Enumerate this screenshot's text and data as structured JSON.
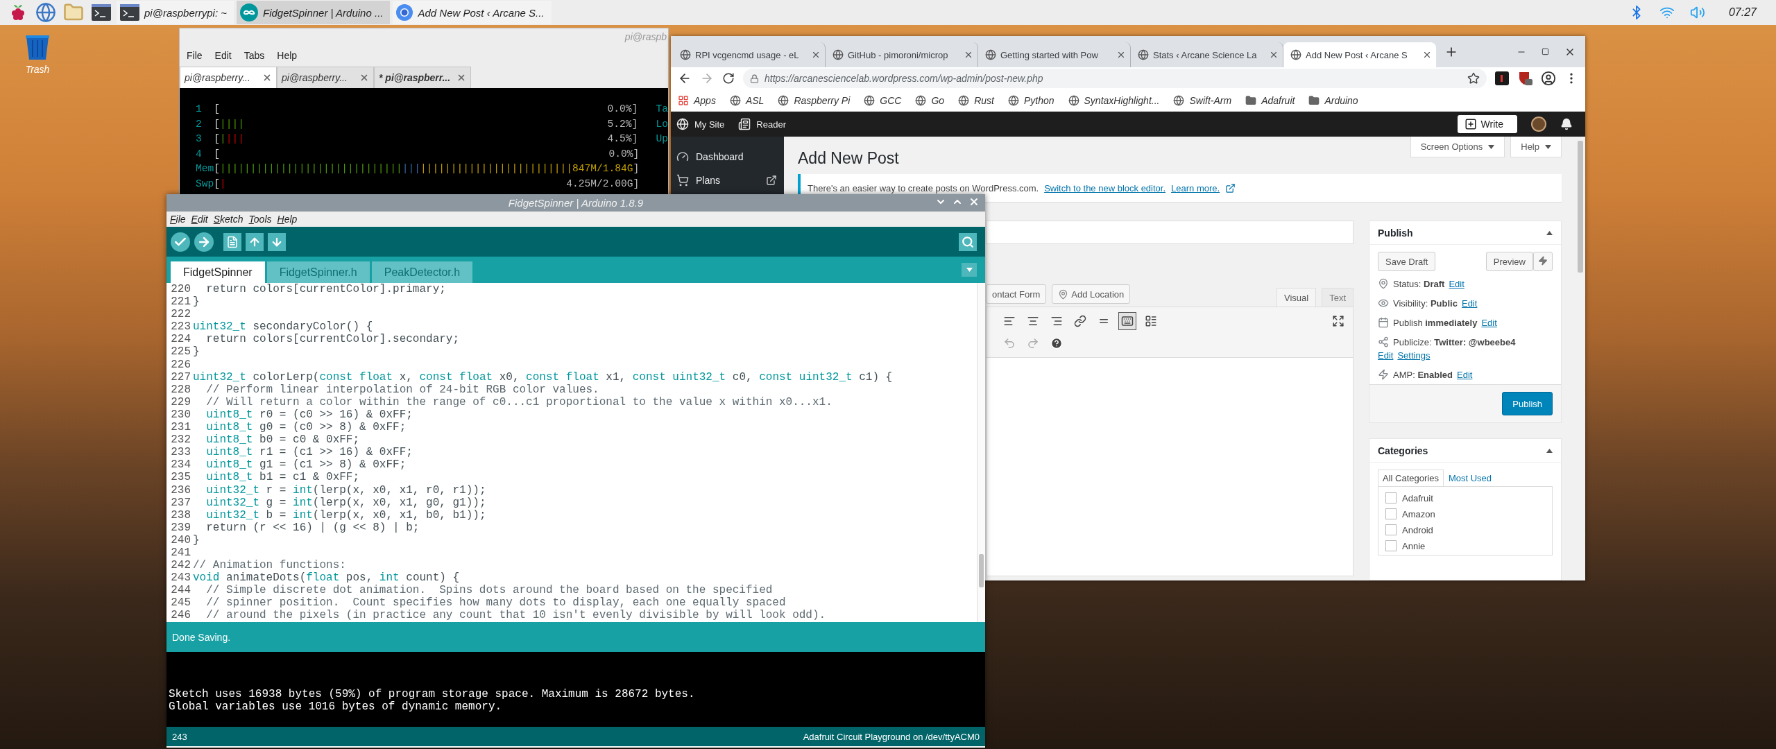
{
  "taskbar": {
    "tasks": [
      {
        "label": "pi@raspberrypi: ~",
        "kind": "terminal",
        "selected": false
      },
      {
        "label": "FidgetSpinner | Arduino ...",
        "kind": "arduino",
        "selected": true
      },
      {
        "label": "Add New Post ‹ Arcane S...",
        "kind": "browser",
        "selected": false
      }
    ],
    "clock": "07:27"
  },
  "desktop": {
    "icons": [
      {
        "label": "Trash"
      }
    ]
  },
  "terminal": {
    "title": "pi@raspb",
    "menu": [
      "File",
      "Edit",
      "Tabs",
      "Help"
    ],
    "tabs": [
      {
        "label": "pi@raspberry...",
        "selected": true,
        "modified": false
      },
      {
        "label": "pi@raspberry...",
        "selected": false,
        "modified": false
      },
      {
        "label": "* pi@raspberr...",
        "selected": false,
        "modified": true
      }
    ],
    "meters": [
      {
        "label": "1",
        "bracket": "[",
        "value": "0.0%]",
        "side": "Ta"
      },
      {
        "label": "2",
        "bracket": "[",
        "segments": [
          {
            "text": "||||",
            "color": "#4e9a06"
          }
        ],
        "value": "5.2%]",
        "side": "Lo"
      },
      {
        "label": "3",
        "bracket": "[",
        "segments": [
          {
            "text": "|",
            "color": "#4e9a06"
          },
          {
            "text": "|||",
            "color": "#cc0000"
          }
        ],
        "value": "4.5%]",
        "side": "Up"
      },
      {
        "label": "4",
        "bracket": "[",
        "value": "0.0%]"
      },
      {
        "label": "Mem",
        "bracket": "[",
        "segments": [
          {
            "text": "||||||||||||||||||||||||||||||",
            "color": "#4e9a06"
          },
          {
            "text": "|||",
            "color": "#3465a4"
          },
          {
            "text": "|||||||||||||||||||||||||847M/1.84G",
            "color": "#c4a000"
          }
        ],
        "value": "]"
      },
      {
        "label": "Swp",
        "bracket": "[",
        "segments": [
          {
            "text": "|",
            "color": "#cc0000"
          }
        ],
        "value": "4.25M/2.00G]"
      }
    ]
  },
  "browser": {
    "tabs": [
      {
        "label": "RPI vcgencmd usage - eL",
        "selected": false
      },
      {
        "label": "GitHub - pimoroni/microp",
        "selected": false
      },
      {
        "label": "Getting started with Pow",
        "selected": false
      },
      {
        "label": "Stats ‹ Arcane Science La",
        "selected": false
      },
      {
        "label": "Add New Post ‹ Arcane S",
        "selected": true
      }
    ],
    "url": "https://arcanesciencelab.wordpress.com/wp-admin/post-new.php",
    "bookmarks": [
      {
        "label": "Apps",
        "kind": "apps"
      },
      {
        "label": "ASL",
        "kind": "site"
      },
      {
        "label": "Raspberry Pi",
        "kind": "site"
      },
      {
        "label": "GCC",
        "kind": "site"
      },
      {
        "label": "Go",
        "kind": "site"
      },
      {
        "label": "Rust",
        "kind": "site"
      },
      {
        "label": "Python",
        "kind": "site"
      },
      {
        "label": "SyntaxHighlight...",
        "kind": "site"
      },
      {
        "label": "Swift-Arm",
        "kind": "site"
      },
      {
        "label": "Adafruit",
        "kind": "folder"
      },
      {
        "label": "Arduino",
        "kind": "folder"
      }
    ]
  },
  "wordpress": {
    "admin_bar": {
      "items": [
        "My Site",
        "Reader"
      ],
      "write": "Write"
    },
    "sidebar": [
      {
        "label": "Dashboard",
        "kind": "dashboard",
        "external": false
      },
      {
        "label": "Plans",
        "kind": "plans",
        "external": true
      }
    ],
    "screen_options": "Screen Options",
    "help": "Help",
    "heading": "Add New Post",
    "notice": {
      "text": "There's an easier way to create posts on WordPress.com.",
      "links": [
        "Switch to the new block editor.",
        "Learn more."
      ]
    },
    "editor": {
      "media_buttons": [
        {
          "label": "ontact Form",
          "kind": "form"
        },
        {
          "label": "Add Location",
          "kind": "location"
        }
      ],
      "tabs": [
        {
          "label": "Visual",
          "selected": true
        },
        {
          "label": "Text",
          "selected": false
        }
      ],
      "toolbar_toggle_on": true
    },
    "publish": {
      "title": "Publish",
      "save_draft": "Save Draft",
      "preview": "Preview",
      "rows": [
        {
          "kind": "status",
          "text": "Status: **Draft**",
          "links": [
            "Edit"
          ],
          "links_below": false
        },
        {
          "kind": "visibility",
          "text": "Visibility: **Public**",
          "links": [
            "Edit"
          ],
          "links_below": false
        },
        {
          "kind": "schedule",
          "text": "Publish **immediately**",
          "links": [
            "Edit"
          ],
          "links_below": false
        },
        {
          "kind": "publicize",
          "text": "Publicize: **Twitter: @wbeebe4**",
          "links": [
            "Edit",
            "Settings"
          ],
          "links_below": true
        },
        {
          "kind": "amp",
          "text": "AMP: **Enabled**",
          "links": [
            "Edit"
          ],
          "links_below": false
        }
      ],
      "button": "Publish"
    },
    "categories": {
      "title": "Categories",
      "tabs": [
        {
          "label": "All Categories",
          "selected": true
        },
        {
          "label": "Most Used",
          "selected": false
        }
      ],
      "items": [
        {
          "label": "Adafruit",
          "checked": false
        },
        {
          "label": "Amazon",
          "checked": false
        },
        {
          "label": "Android",
          "checked": false
        },
        {
          "label": "Annie",
          "checked": false
        }
      ]
    }
  },
  "arduino": {
    "title": "FidgetSpinner | Arduino 1.8.9",
    "menu": [
      "File",
      "Edit",
      "Sketch",
      "Tools",
      "Help"
    ],
    "tabs": [
      {
        "label": "FidgetSpinner",
        "selected": true
      },
      {
        "label": "FidgetSpinner.h",
        "selected": false
      },
      {
        "label": "PeakDetector.h",
        "selected": false
      }
    ],
    "code": [
      {
        "number": "220",
        "tokens": [
          {
            "text": "  return colors[currentColor].primary;",
            "kind": "plain"
          }
        ]
      },
      {
        "number": "221",
        "tokens": [
          {
            "text": "}",
            "kind": "plain"
          }
        ]
      },
      {
        "number": "222"
      },
      {
        "number": "223",
        "tokens": [
          {
            "text": "uint32_t",
            "kind": "keyword"
          },
          {
            "text": " secondaryColor() {",
            "kind": "plain"
          }
        ]
      },
      {
        "number": "224",
        "tokens": [
          {
            "text": "  return colors[currentColor].secondary;",
            "kind": "plain"
          }
        ]
      },
      {
        "number": "225",
        "tokens": [
          {
            "text": "}",
            "kind": "plain"
          }
        ]
      },
      {
        "number": "226"
      },
      {
        "number": "227",
        "tokens": [
          {
            "text": "uint32_t",
            "kind": "keyword"
          },
          {
            "text": " colorLerp(",
            "kind": "plain"
          },
          {
            "text": "const float",
            "kind": "keyword"
          },
          {
            "text": " x, ",
            "kind": "plain"
          },
          {
            "text": "const float",
            "kind": "keyword"
          },
          {
            "text": " x0, ",
            "kind": "plain"
          },
          {
            "text": "const float",
            "kind": "keyword"
          },
          {
            "text": " x1, ",
            "kind": "plain"
          },
          {
            "text": "const uint32_t",
            "kind": "keyword"
          },
          {
            "text": " c0, ",
            "kind": "plain"
          },
          {
            "text": "const uint32_t",
            "kind": "keyword"
          },
          {
            "text": " c1) {",
            "kind": "plain"
          }
        ]
      },
      {
        "number": "228",
        "tokens": [
          {
            "text": "  // Perform linear interpolation of 24-bit RGB color values.",
            "kind": "comment"
          }
        ]
      },
      {
        "number": "229",
        "tokens": [
          {
            "text": "  // Will return a color within the range of c0...c1 proportional to the value x within x0...x1.",
            "kind": "comment"
          }
        ]
      },
      {
        "number": "230",
        "tokens": [
          {
            "text": "  uint8_t",
            "kind": "keyword"
          },
          {
            "text": " r0 = (c0 >> 16) & 0xFF;",
            "kind": "plain"
          }
        ]
      },
      {
        "number": "231",
        "tokens": [
          {
            "text": "  uint8_t",
            "kind": "keyword"
          },
          {
            "text": " g0 = (c0 >> 8) & 0xFF;",
            "kind": "plain"
          }
        ]
      },
      {
        "number": "232",
        "tokens": [
          {
            "text": "  uint8_t",
            "kind": "keyword"
          },
          {
            "text": " b0 = c0 & 0xFF;",
            "kind": "plain"
          }
        ]
      },
      {
        "number": "233",
        "tokens": [
          {
            "text": "  uint8_t",
            "kind": "keyword"
          },
          {
            "text": " r1 = (c1 >> 16) & 0xFF;",
            "kind": "plain"
          }
        ]
      },
      {
        "number": "234",
        "tokens": [
          {
            "text": "  uint8_t",
            "kind": "keyword"
          },
          {
            "text": " g1 = (c1 >> 8) & 0xFF;",
            "kind": "plain"
          }
        ]
      },
      {
        "number": "235",
        "tokens": [
          {
            "text": "  uint8_t",
            "kind": "keyword"
          },
          {
            "text": " b1 = c1 & 0xFF;",
            "kind": "plain"
          }
        ]
      },
      {
        "number": "236",
        "tokens": [
          {
            "text": "  uint32_t",
            "kind": "keyword"
          },
          {
            "text": " r = ",
            "kind": "plain"
          },
          {
            "text": "int",
            "kind": "keyword"
          },
          {
            "text": "(lerp(x, x0, x1, r0, r1));",
            "kind": "plain"
          }
        ]
      },
      {
        "number": "237",
        "tokens": [
          {
            "text": "  uint32_t",
            "kind": "keyword"
          },
          {
            "text": " g = ",
            "kind": "plain"
          },
          {
            "text": "int",
            "kind": "keyword"
          },
          {
            "text": "(lerp(x, x0, x1, g0, g1));",
            "kind": "plain"
          }
        ]
      },
      {
        "number": "238",
        "tokens": [
          {
            "text": "  uint32_t",
            "kind": "keyword"
          },
          {
            "text": " b = ",
            "kind": "plain"
          },
          {
            "text": "int",
            "kind": "keyword"
          },
          {
            "text": "(lerp(x, x0, x1, b0, b1));",
            "kind": "plain"
          }
        ]
      },
      {
        "number": "239",
        "tokens": [
          {
            "text": "  return (r << 16) | (g << 8) | b;",
            "kind": "plain"
          }
        ]
      },
      {
        "number": "240",
        "tokens": [
          {
            "text": "}",
            "kind": "plain"
          }
        ]
      },
      {
        "number": "241"
      },
      {
        "number": "242",
        "tokens": [
          {
            "text": "// Animation functions:",
            "kind": "comment"
          }
        ]
      },
      {
        "number": "243",
        "tokens": [
          {
            "text": "void",
            "kind": "keyword"
          },
          {
            "text": " animateDots(",
            "kind": "plain"
          },
          {
            "text": "float",
            "kind": "keyword"
          },
          {
            "text": " pos, ",
            "kind": "plain"
          },
          {
            "text": "int",
            "kind": "keyword"
          },
          {
            "text": " count) {",
            "kind": "plain"
          }
        ]
      },
      {
        "number": "244",
        "tokens": [
          {
            "text": "  // Simple discrete dot animation.  Spins dots around the board based on the specified",
            "kind": "comment"
          }
        ]
      },
      {
        "number": "245",
        "tokens": [
          {
            "text": "  // spinner position.  Count specifies how many dots to display, each one equally spaced",
            "kind": "comment"
          }
        ]
      },
      {
        "number": "246",
        "tokens": [
          {
            "text": "  // around the pixels (in practice any count that 10 isn't evenly divisible by will look odd).",
            "kind": "comment"
          }
        ]
      }
    ],
    "status": "Done Saving.",
    "console": [
      "Sketch uses 16938 bytes (59%) of program storage space. Maximum is 28672 bytes.",
      "Global variables use 1016 bytes of dynamic memory."
    ],
    "footer": {
      "line": "243",
      "board": "Adafruit Circuit Playground on /dev/ttyACM0"
    }
  }
}
